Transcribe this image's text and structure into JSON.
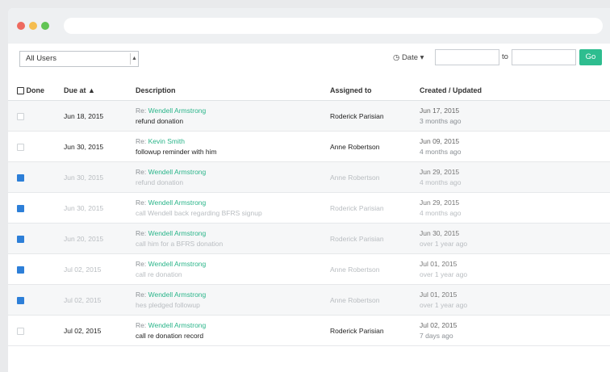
{
  "filters": {
    "user_select_value": "All Users",
    "date_dropdown_label": "Date",
    "to_label": "to",
    "go_label": "Go"
  },
  "table": {
    "headers": [
      "Done",
      "Due at",
      "Description",
      "Assigned to",
      "Created / Updated"
    ],
    "rows": [
      {
        "done": false,
        "due": "Jun 18, 2015",
        "re_prefix": "Re:",
        "contact": "Wendell Armstrong",
        "note": "refund donation",
        "assigned": "Roderick Parisian",
        "created": "Jun 17, 2015",
        "updated": "3 months ago"
      },
      {
        "done": false,
        "due": "Jun 30, 2015",
        "re_prefix": "Re:",
        "contact": "Kevin Smith",
        "note": "followup reminder with him",
        "assigned": "Anne Robertson",
        "created": "Jun 09, 2015",
        "updated": "4 months ago"
      },
      {
        "done": true,
        "due": "Jun 30, 2015",
        "re_prefix": "Re:",
        "contact": "Wendell Armstrong",
        "note": "refund donation",
        "assigned": "Anne Robertson",
        "created": "Jun 29, 2015",
        "updated": "4 months ago"
      },
      {
        "done": true,
        "due": "Jun 30, 2015",
        "re_prefix": "Re:",
        "contact": "Wendell Armstrong",
        "note": "call Wendell back regarding BFRS signup",
        "assigned": "Roderick Parisian",
        "created": "Jun 29, 2015",
        "updated": "4 months ago"
      },
      {
        "done": true,
        "due": "Jun 20, 2015",
        "re_prefix": "Re:",
        "contact": "Wendell Armstrong",
        "note": "call him for a BFRS donation",
        "assigned": "Roderick Parisian",
        "created": "Jun 30, 2015",
        "updated": "over 1 year ago"
      },
      {
        "done": true,
        "due": "Jul 02, 2015",
        "re_prefix": "Re:",
        "contact": "Wendell Armstrong",
        "note": "call re donation",
        "assigned": "Anne Robertson",
        "created": "Jul 01, 2015",
        "updated": "over 1 year ago"
      },
      {
        "done": true,
        "due": "Jul 02, 2015",
        "re_prefix": "Re:",
        "contact": "Wendell Armstrong",
        "note": "hes pledged followup",
        "assigned": "Anne Robertson",
        "created": "Jul 01, 2015",
        "updated": "over 1 year ago"
      },
      {
        "done": false,
        "due": "Jul 02, 2015",
        "re_prefix": "Re:",
        "contact": "Wendell Armstrong",
        "note": "call re donation record",
        "assigned": "Roderick Parisian",
        "created": "Jul 02, 2015",
        "updated": "7 days ago"
      }
    ]
  }
}
